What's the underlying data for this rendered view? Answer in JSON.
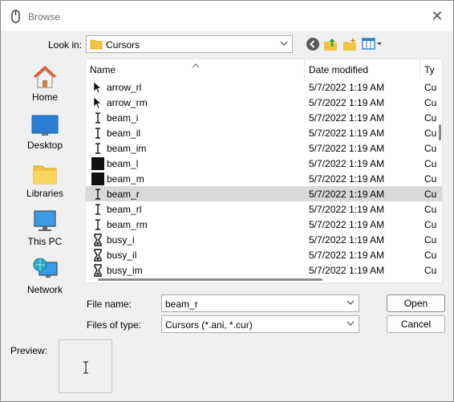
{
  "window": {
    "title": "Browse",
    "close_glyph": "✕"
  },
  "toolbar": {
    "look_in_label": "Look in:",
    "look_in_value": "Cursors",
    "icons": [
      "back-icon",
      "up-folder-icon",
      "new-folder-icon",
      "view-menu-icon"
    ]
  },
  "places": [
    {
      "label": "Home",
      "icon": "home-icon"
    },
    {
      "label": "Desktop",
      "icon": "desktop-icon"
    },
    {
      "label": "Libraries",
      "icon": "libraries-icon"
    },
    {
      "label": "This PC",
      "icon": "this-pc-icon"
    },
    {
      "label": "Network",
      "icon": "network-icon"
    }
  ],
  "files": {
    "columns": {
      "name": "Name",
      "date": "Date modified",
      "type": "Ty"
    },
    "rows": [
      {
        "name": "arrow_rl",
        "date": "5/7/2022 1:19 AM",
        "type": "Cu",
        "icon": "arrow"
      },
      {
        "name": "arrow_rm",
        "date": "5/7/2022 1:19 AM",
        "type": "Cu",
        "icon": "arrow"
      },
      {
        "name": "beam_i",
        "date": "5/7/2022 1:19 AM",
        "type": "Cu",
        "icon": "beam"
      },
      {
        "name": "beam_il",
        "date": "5/7/2022 1:19 AM",
        "type": "Cu",
        "icon": "beam"
      },
      {
        "name": "beam_im",
        "date": "5/7/2022 1:19 AM",
        "type": "Cu",
        "icon": "beam"
      },
      {
        "name": "beam_l",
        "date": "5/7/2022 1:19 AM",
        "type": "Cu",
        "icon": "block"
      },
      {
        "name": "beam_m",
        "date": "5/7/2022 1:19 AM",
        "type": "Cu",
        "icon": "block"
      },
      {
        "name": "beam_r",
        "date": "5/7/2022 1:19 AM",
        "type": "Cu",
        "icon": "beam",
        "selected": true
      },
      {
        "name": "beam_rl",
        "date": "5/7/2022 1:19 AM",
        "type": "Cu",
        "icon": "beam"
      },
      {
        "name": "beam_rm",
        "date": "5/7/2022 1:19 AM",
        "type": "Cu",
        "icon": "beam"
      },
      {
        "name": "busy_i",
        "date": "5/7/2022 1:19 AM",
        "type": "Cu",
        "icon": "hourglass"
      },
      {
        "name": "busy_il",
        "date": "5/7/2022 1:19 AM",
        "type": "Cu",
        "icon": "hourglass"
      },
      {
        "name": "busy_im",
        "date": "5/7/2022 1:19 AM",
        "type": "Cu",
        "icon": "hourglass"
      }
    ]
  },
  "form": {
    "file_name_label": "File name:",
    "file_name_value": "beam_r",
    "file_type_label": "Files of type:",
    "file_type_value": "Cursors (*.ani, *.cur)",
    "open_label": "Open",
    "cancel_label": "Cancel"
  },
  "preview": {
    "label": "Preview:",
    "icon": "text-beam-cursor-icon"
  },
  "colors": {
    "selection": "#d9d9d9",
    "folder": "#f6c443",
    "accent": "#2a7fd4"
  }
}
